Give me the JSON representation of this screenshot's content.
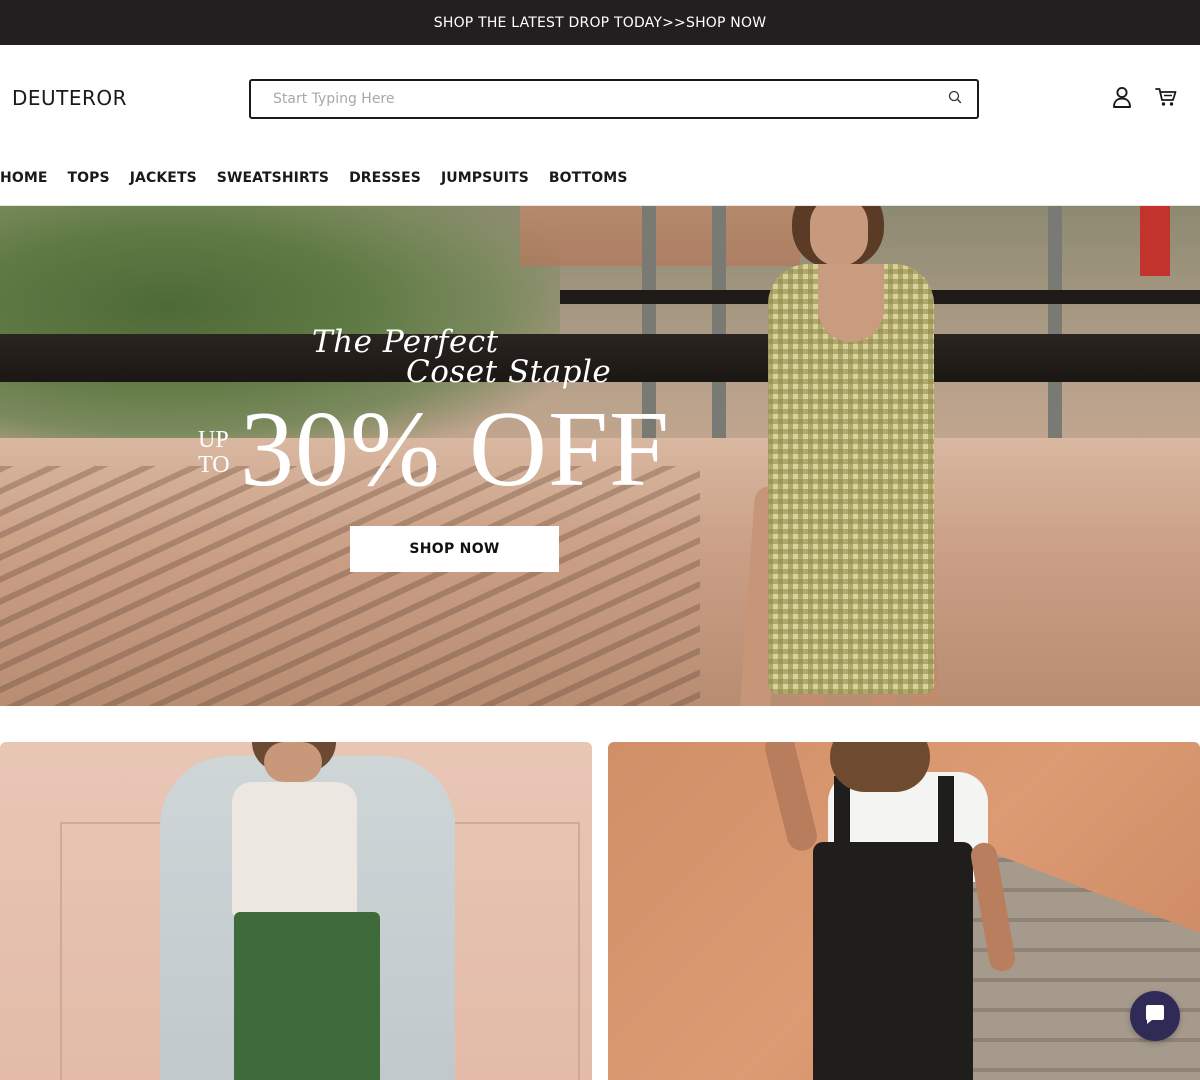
{
  "announcement": {
    "text": "SHOP THE LATEST DROP TODAY>>SHOP NOW"
  },
  "header": {
    "logo": "DEUTEROR",
    "search": {
      "placeholder": "Start Typing Here",
      "value": "",
      "icon": "search-icon"
    },
    "icons": {
      "account": "user-icon",
      "cart": "cart-icon"
    }
  },
  "nav": {
    "items": [
      {
        "label": "HOME"
      },
      {
        "label": "TOPS"
      },
      {
        "label": "JACKETS"
      },
      {
        "label": "SWEATSHIRTS"
      },
      {
        "label": "DRESSES"
      },
      {
        "label": "JUMPSUITS"
      },
      {
        "label": "BOTTOMS"
      }
    ]
  },
  "hero": {
    "title_line1": "The Perfect",
    "title_line2": "Coset Staple",
    "upto_line1": "UP",
    "upto_line2": "TO",
    "offer": "30% OFF",
    "cta": "SHOP NOW"
  },
  "chat": {
    "icon": "chat-bubble-icon",
    "color": "#2f2b56"
  },
  "colors": {
    "announcement_bg": "#231f20",
    "text": "#1a1a1a",
    "cta_bg": "#ffffff"
  }
}
